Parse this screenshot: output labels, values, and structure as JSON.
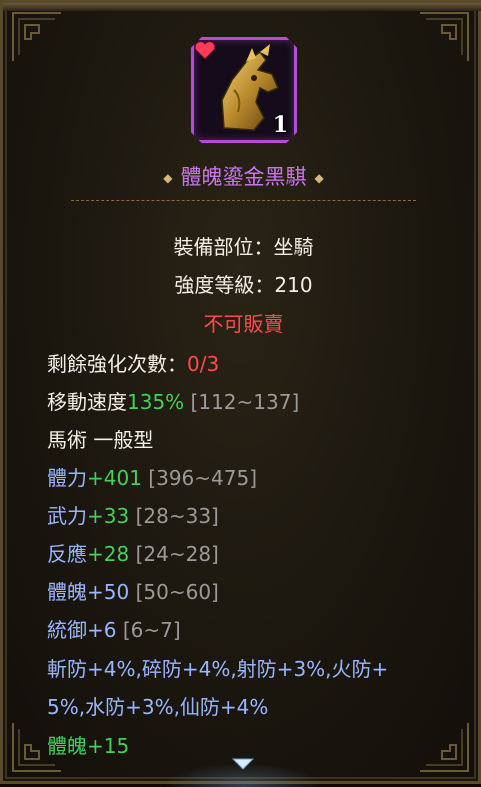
{
  "item": {
    "name": "體魄鎏金黑騏",
    "stack_count": "1",
    "icon": "golden-dragon-horse-helm-icon"
  },
  "info": {
    "slot": "裝備部位：坐騎",
    "level": "強度等級：210",
    "not_sellable": "不可販賣"
  },
  "enhance": {
    "label": "剩餘強化次數：",
    "value": "0/3"
  },
  "move_speed": {
    "label": "移動速度",
    "value": "135%",
    "range": "[112~137]"
  },
  "horse_type": "馬術 一般型",
  "stats": [
    {
      "label": "體力",
      "value": "+401",
      "range": "[396~475]"
    },
    {
      "label": "武力",
      "value": "+33",
      "range": "[28~33]"
    },
    {
      "label": "反應",
      "value": "+28",
      "range": "[24~28]"
    },
    {
      "label": "體魄",
      "value": "+50",
      "range": "[50~60]"
    },
    {
      "label": "統御",
      "value": "+6",
      "range": "[6~7]"
    }
  ],
  "resist": {
    "line1": "斬防+4%,碎防+4%,射防+3%,火防+",
    "line2": "5%,水防+3%,仙防+4%"
  },
  "bonus": {
    "label": "體魄",
    "value": "+15"
  },
  "colors": {
    "title": "#c877e8",
    "stat_label": "#9ab6ff",
    "stat_value": "#46d05a",
    "warning": "#ff4b4b",
    "range": "#9a9a9a"
  }
}
